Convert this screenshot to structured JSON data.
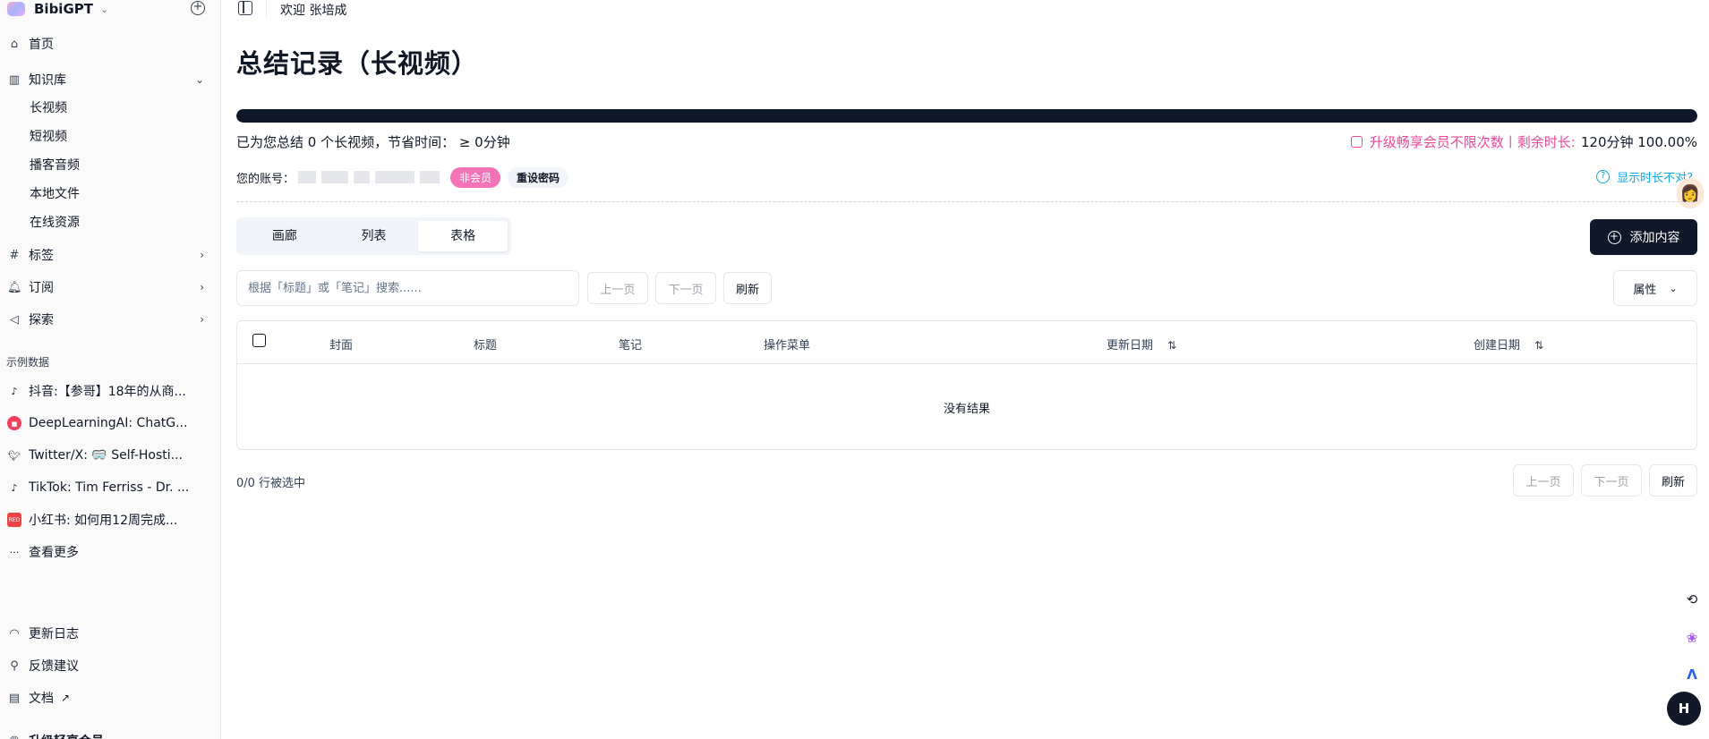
{
  "app": {
    "name": "BibiGPT"
  },
  "sidebar": {
    "nav": [
      {
        "label": "首页",
        "icon": "home-icon"
      },
      {
        "label": "知识库",
        "icon": "library-icon"
      },
      {
        "label": "标签",
        "icon": "hash-icon"
      },
      {
        "label": "订阅",
        "icon": "bell-icon"
      },
      {
        "label": "探索",
        "icon": "megaphone-icon"
      }
    ],
    "library_sub": [
      "长视频",
      "短视频",
      "播客音频",
      "本地文件",
      "在线资源"
    ],
    "samples_title": "示例数据",
    "samples": [
      {
        "label": "抖音:【参哥】18年的从商...",
        "icon": "tiktok-icon"
      },
      {
        "label": "DeepLearningAI: ChatG...",
        "icon": "bilibili-icon"
      },
      {
        "label": "Twitter/X: 🥽 Self-Hosti...",
        "icon": "twitter-icon"
      },
      {
        "label": "TikTok: Tim Ferriss - Dr. ...",
        "icon": "tiktok-icon"
      },
      {
        "label": "小红书: 如何用12周完成...",
        "icon": "xiaohongshu-icon"
      }
    ],
    "more": "查看更多",
    "footer": [
      {
        "label": "更新日志",
        "icon": "rss-icon"
      },
      {
        "label": "反馈建议",
        "icon": "location-icon"
      },
      {
        "label": "文档",
        "icon": "document-icon"
      }
    ],
    "cutoff": "升级轻享会员"
  },
  "topbar": {
    "welcome": "欢迎 张培成"
  },
  "main": {
    "title": "总结记录（长视频）",
    "progress_fraction": 1.0,
    "stats_left": "已为您总结 0 个长视频，节省时间： ≥ 0分钟",
    "upgrade_text": "升级畅享会员不限次数丨剩余时长:",
    "remaining": "120分钟 100.00%",
    "account_label": "您的账号：",
    "badge_member": "非会员",
    "badge_reset": "重设密码",
    "help_text": "显示时长不对?",
    "tabs": [
      "画廊",
      "列表",
      "表格"
    ],
    "active_tab": 2,
    "add_button": "添加内容",
    "search_placeholder": "根据「标题」或「笔记」搜索......",
    "prev_page": "上一页",
    "next_page": "下一页",
    "refresh": "刷新",
    "attributes": "属性",
    "columns": [
      "封面",
      "标题",
      "笔记",
      "操作菜单",
      "更新日期",
      "创建日期"
    ],
    "empty_text": "没有结果",
    "selected_count": "0/0 行被选中"
  },
  "colors": {
    "primary": "#0f172a",
    "pink": "#ec4899",
    "link": "#0ea5e9"
  }
}
